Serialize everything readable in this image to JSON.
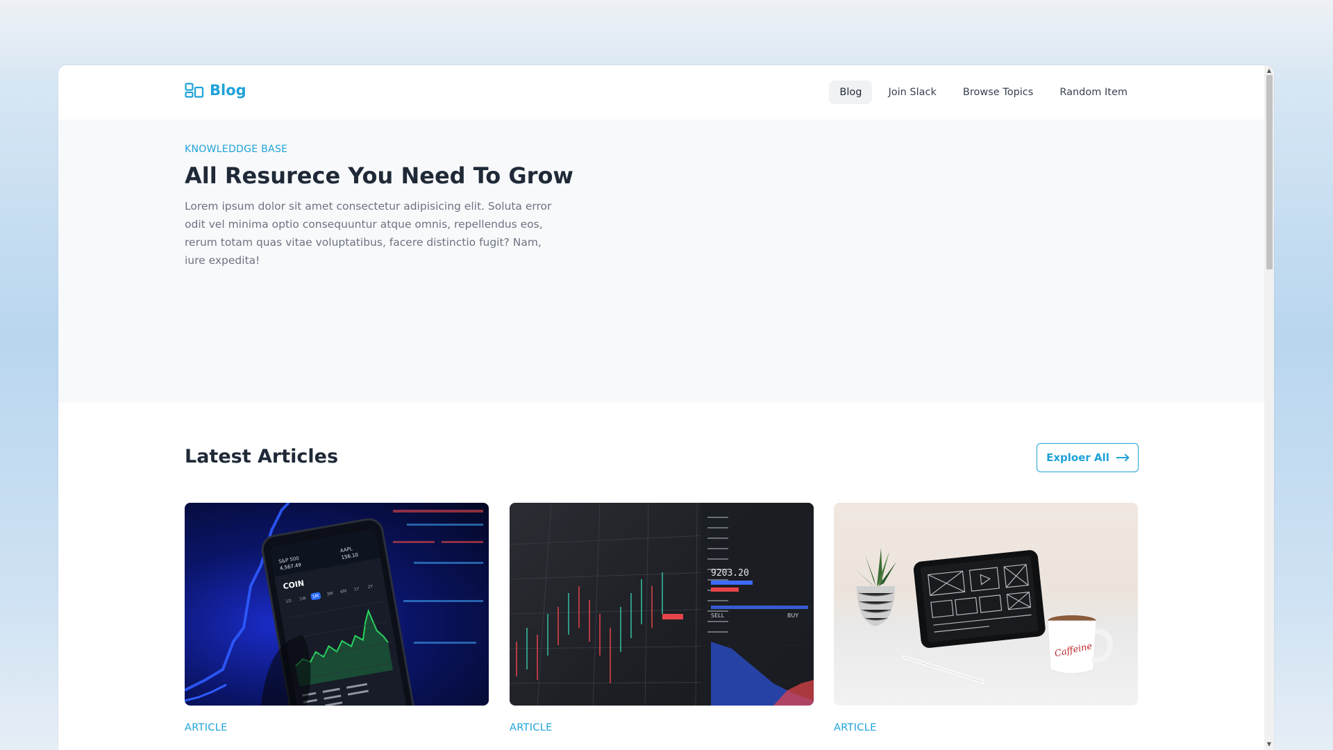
{
  "header": {
    "logo_text": "Blog",
    "nav": [
      {
        "label": "Blog",
        "active": true
      },
      {
        "label": "Join Slack",
        "active": false
      },
      {
        "label": "Browse Topics",
        "active": false
      },
      {
        "label": "Random Item",
        "active": false
      }
    ]
  },
  "hero": {
    "eyebrow": "KNOWLEDDGE BASE",
    "title": "All Resurece You Need To Grow",
    "description": "Lorem ipsum dolor sit amet consectetur adipisicing elit. Soluta error odit vel minima optio consequuntur atque omnis, repellendus eos, rerum totam quas vitae voluptatibus, facere distinctio fugit? Nam, iure expedita!"
  },
  "latest": {
    "title": "Latest Articles",
    "explore_label": "Exploer All",
    "cards": [
      {
        "category": "ARTICLE",
        "image": "stock-app-phone"
      },
      {
        "category": "ARTICLE",
        "image": "trading-chart-screen"
      },
      {
        "category": "ARTICLE",
        "image": "tablet-desk-coffee"
      }
    ]
  },
  "phone_app": {
    "ticker_1": "S&P 500",
    "ticker_1_value": "4,567.49",
    "ticker_2": "AAPL",
    "ticker_2_value": "156.10",
    "coin": "COIN",
    "ranges": [
      "1D",
      "1W",
      "1M",
      "3M",
      "6M",
      "1Y",
      "2Y"
    ]
  },
  "trading_screen": {
    "price": "9203.20",
    "sell": "SELL",
    "buy": "BUY"
  },
  "mug_text": "Caffeine",
  "colors": {
    "accent": "#1fa2d8",
    "heading": "#1f2937",
    "body_text": "#6b7280",
    "hero_bg": "#f8f9fb"
  }
}
